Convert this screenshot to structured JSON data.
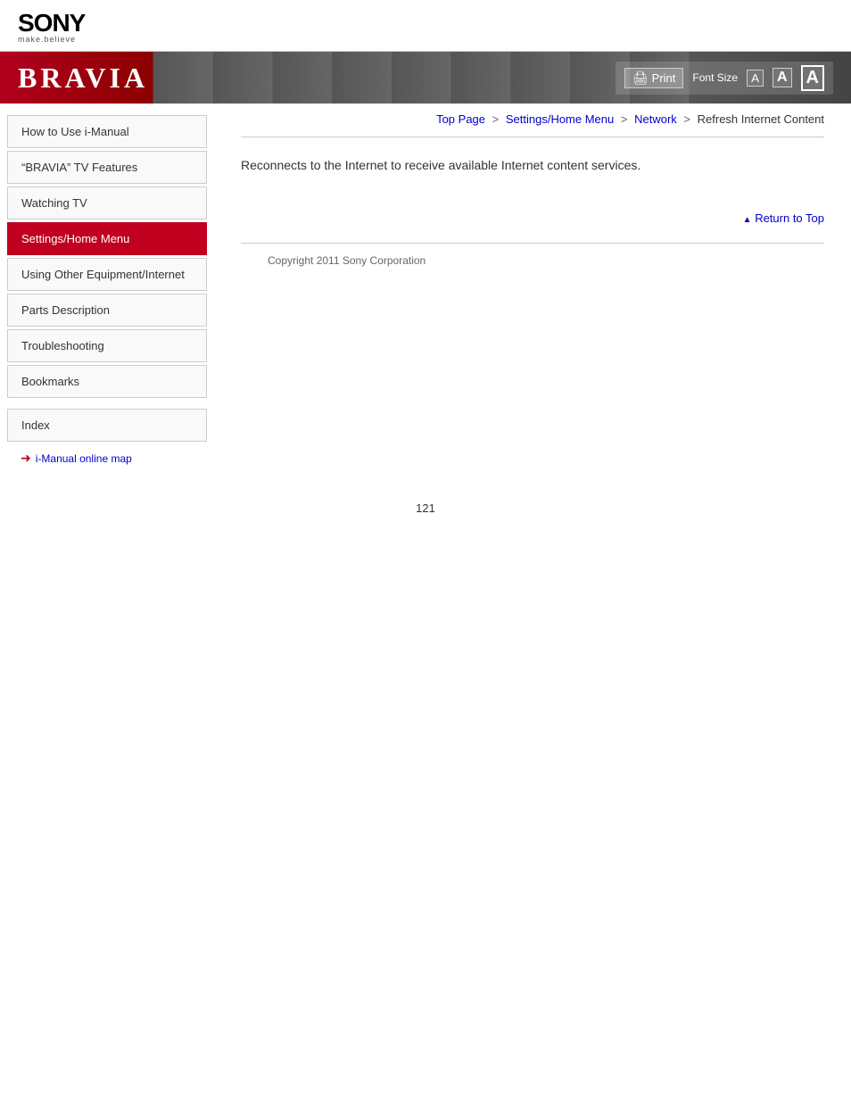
{
  "header": {
    "sony_text": "SONY",
    "tagline": "make.believe"
  },
  "banner": {
    "title": "BRAVIA",
    "print_label": "Print",
    "font_size_label": "Font Size",
    "font_size_small": "A",
    "font_size_medium": "A",
    "font_size_large": "A"
  },
  "breadcrumb": {
    "top_page": "Top Page",
    "settings": "Settings/Home Menu",
    "network": "Network",
    "current": "Refresh Internet Content"
  },
  "sidebar": {
    "items": [
      {
        "label": "How to Use i-Manual",
        "active": false
      },
      {
        "label": "“BRAVIA” TV Features",
        "active": false
      },
      {
        "label": "Watching TV",
        "active": false
      },
      {
        "label": "Settings/Home Menu",
        "active": true
      },
      {
        "label": "Using Other Equipment/Internet",
        "active": false
      },
      {
        "label": "Parts Description",
        "active": false
      },
      {
        "label": "Troubleshooting",
        "active": false
      },
      {
        "label": "Bookmarks",
        "active": false
      }
    ],
    "index_label": "Index",
    "online_map_label": "i-Manual online map"
  },
  "content": {
    "body_text": "Reconnects to the Internet to receive available Internet content services."
  },
  "return_to_top": "Return to Top",
  "footer": {
    "copyright": "Copyright 2011 Sony Corporation"
  },
  "page_number": "121"
}
